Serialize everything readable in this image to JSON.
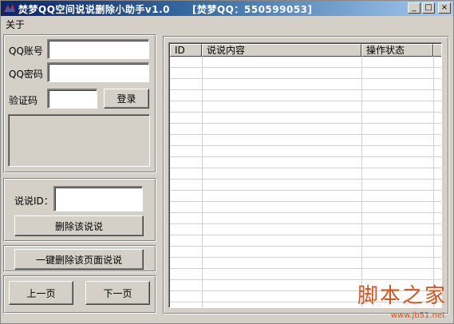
{
  "window": {
    "title": "焚梦QQ空间说说删除小助手v1.0",
    "title_extra": "[焚梦QQ：550599053]",
    "minimize_glyph": "_",
    "maximize_glyph": "□",
    "close_glyph": "×"
  },
  "menu": {
    "about": "关于"
  },
  "login": {
    "qq_account_label": "QQ账号",
    "qq_account_value": "",
    "qq_password_label": "QQ密码",
    "qq_password_value": "",
    "captcha_label": "验证码",
    "captcha_value": "",
    "login_button": "登录"
  },
  "delete_panel": {
    "shuoshuo_id_label": "说说ID：",
    "shuoshuo_id_value": "",
    "delete_button": "删除该说说",
    "delete_page_button": "一键删除该页面说说"
  },
  "pager": {
    "prev_button": "上一页",
    "next_button": "下一页"
  },
  "list": {
    "columns": [
      "ID",
      "说说内容",
      "操作状态"
    ],
    "rows": []
  },
  "watermark": {
    "text": "脚本之家",
    "url": "www.jb51.net"
  },
  "colors": {
    "title_start": "#0a246a",
    "title_end": "#a6caf0",
    "face": "#d4d0c8",
    "watermark": "#d9531e"
  }
}
